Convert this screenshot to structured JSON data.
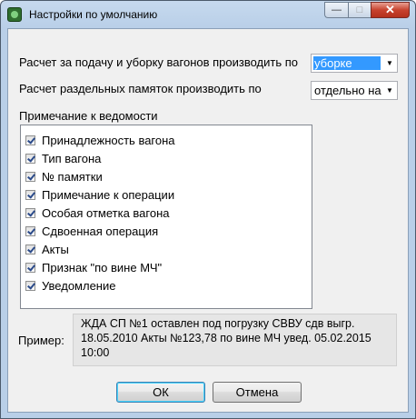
{
  "window": {
    "title": "Настройки по умолчанию",
    "icon": "app-icon"
  },
  "settings": {
    "supply_label": "Расчет за подачу и уборку вагонов производить по",
    "supply_value": "уборке",
    "memo_label": "Расчет раздельных памяток производить по",
    "memo_value": "отдельно на"
  },
  "notes": {
    "heading": "Примечание к ведомости",
    "items": [
      {
        "label": "Принадлежность вагона",
        "checked": true
      },
      {
        "label": "Тип вагона",
        "checked": true
      },
      {
        "label": "№ памятки",
        "checked": true
      },
      {
        "label": "Примечание к операции",
        "checked": true
      },
      {
        "label": "Особая отметка вагона",
        "checked": true
      },
      {
        "label": "Сдвоенная операция",
        "checked": true
      },
      {
        "label": "Акты",
        "checked": true
      },
      {
        "label": "Признак \"по вине МЧ\"",
        "checked": true
      },
      {
        "label": "Уведомление",
        "checked": true
      }
    ]
  },
  "example": {
    "label": "Пример:",
    "text": "ЖДА СП №1 оставлен под погрузку СВВУ сдв выгр. 18.05.2010 Акты №123,78 по вине МЧ увед. 05.02.2015 10:00"
  },
  "buttons": {
    "ok": "ОК",
    "cancel": "Отмена"
  }
}
